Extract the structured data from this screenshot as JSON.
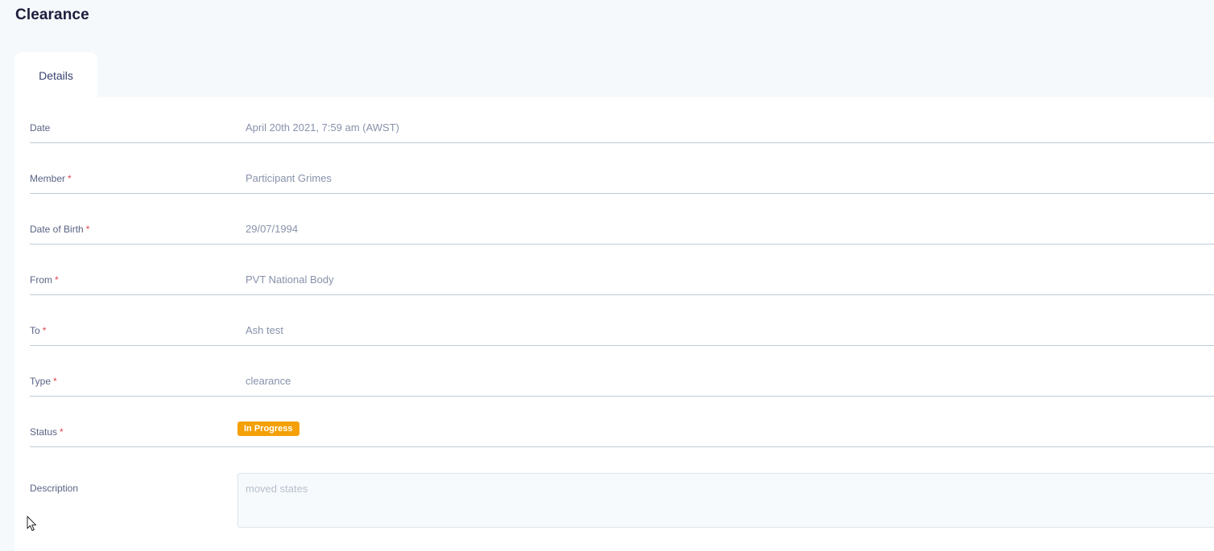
{
  "page": {
    "title": "Clearance"
  },
  "tabs": [
    {
      "label": "Details",
      "active": true
    }
  ],
  "fields": {
    "date": {
      "label": "Date",
      "value": "April 20th 2021, 7:59 am (AWST)"
    },
    "member": {
      "label": "Member",
      "required_mark": "*",
      "value": "Participant Grimes"
    },
    "dob": {
      "label": "Date of Birth",
      "required_mark": "*",
      "value": "29/07/1994"
    },
    "from": {
      "label": "From",
      "required_mark": "*",
      "value": "PVT National Body"
    },
    "to": {
      "label": "To",
      "required_mark": "*",
      "value": "Ash test"
    },
    "type": {
      "label": "Type",
      "required_mark": "*",
      "value": "clearance"
    },
    "status": {
      "label": "Status",
      "required_mark": "*",
      "value": "In Progress",
      "badge_color": "#f4a006"
    },
    "description": {
      "label": "Description",
      "value": "moved states"
    }
  },
  "cursor": {
    "icon": "mouse-pointer-icon"
  }
}
